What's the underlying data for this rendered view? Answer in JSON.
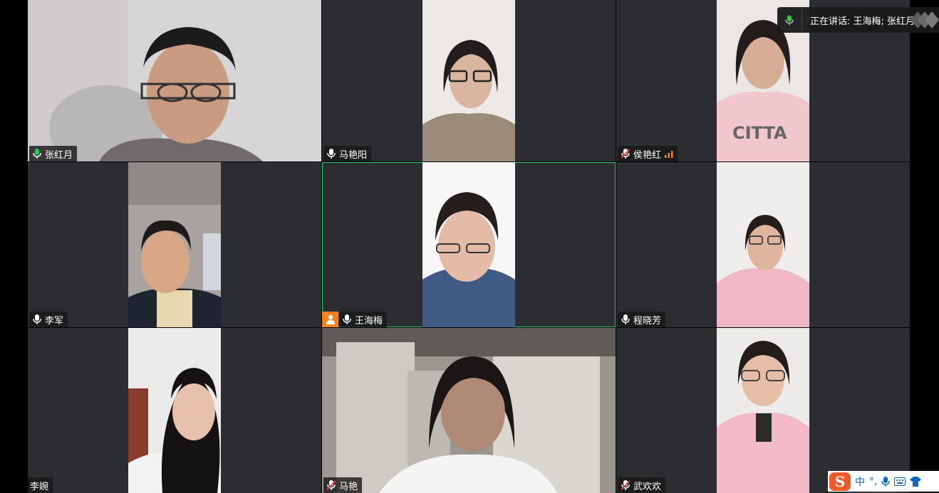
{
  "speaking": {
    "label": "正在讲话: 王海梅; 张红月;"
  },
  "participants": [
    {
      "name": "张红月",
      "mic": "talking"
    },
    {
      "name": "马艳阳",
      "mic": "on"
    },
    {
      "name": "侯艳红",
      "mic": "muted",
      "signal": "weak"
    },
    {
      "name": "李军",
      "mic": "on"
    },
    {
      "name": "王海梅",
      "mic": "on",
      "host": true,
      "active": true
    },
    {
      "name": "程晓芳",
      "mic": "on"
    },
    {
      "name": "李婉",
      "mic": "none"
    },
    {
      "name": "马艳",
      "mic": "muted"
    },
    {
      "name": "武欢欢",
      "mic": "muted"
    }
  ],
  "ime": {
    "logo": "S",
    "mode": "中",
    "punct": "°,"
  },
  "colors": {
    "tile_bg": "#2b2d30",
    "active_border": "#2ecc71",
    "host_badge": "#f5821f",
    "mic_talking": "#38c948",
    "mic_muted": "#e53935"
  }
}
